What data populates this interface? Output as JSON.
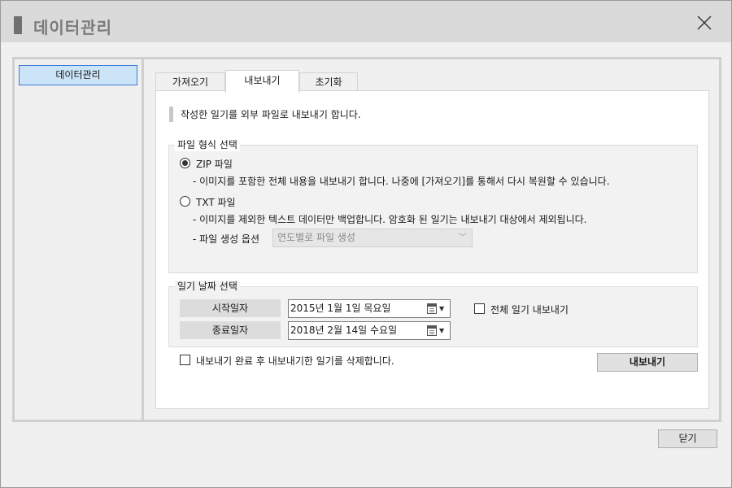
{
  "window": {
    "title": "데이터관리"
  },
  "sidebar": {
    "items": [
      {
        "label": "데이터관리",
        "selected": true
      }
    ]
  },
  "tabs": [
    {
      "label": "가져오기",
      "active": false
    },
    {
      "label": "내보내기",
      "active": true
    },
    {
      "label": "초기화",
      "active": false
    }
  ],
  "export": {
    "description": "작성한 일기를 외부 파일로 내보내기 합니다.",
    "file_format": {
      "title": "파일 형식 선택",
      "zip": {
        "label": "ZIP 파일",
        "selected": true,
        "desc": "- 이미지를 포함한 전체 내용을 내보내기 합니다. 나중에 [가져오기]를 통해서 다시 복원할 수 있습니다."
      },
      "txt": {
        "label": "TXT 파일",
        "selected": false,
        "desc": "- 이미지를 제외한 텍스트 데이터만 백업합니다. 암호화 된 일기는 내보내기 대상에서 제외됩니다.",
        "option_label": "- 파일 생성 옵션",
        "option_value": "연도별로 파일 생성",
        "option_disabled": true
      }
    },
    "date_range": {
      "title": "일기 날짜 선택",
      "start_label": "시작일자",
      "start_value": "2015년   1월   1일 목요일",
      "end_label": "종료일자",
      "end_value": "2018년   2월 14일 수요일",
      "all_label": "전체 일기 내보내기",
      "all_checked": false
    },
    "delete_after": {
      "label": "내보내기 완료 후 내보내기한 일기를 삭제합니다.",
      "checked": false
    },
    "export_button": "내보내기"
  },
  "footer": {
    "close_button": "닫기"
  },
  "colors": {
    "titlebar": "#dadada",
    "selection": "#cce4f7",
    "selection_border": "#3b79d6"
  }
}
